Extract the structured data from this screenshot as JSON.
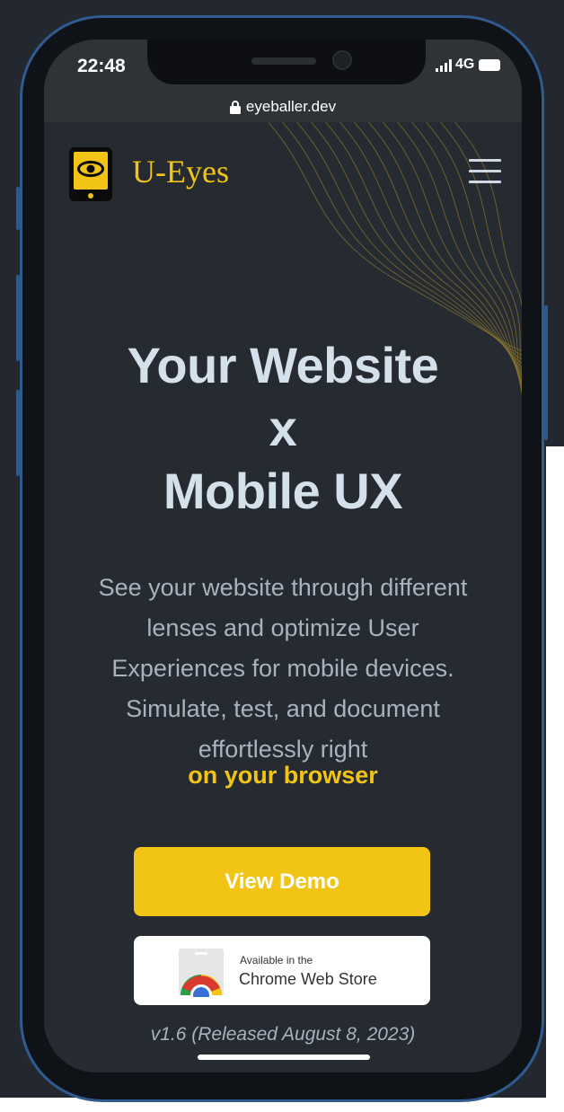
{
  "status_bar": {
    "time": "22:48",
    "network": "4G"
  },
  "browser": {
    "url": "eyeballer.dev"
  },
  "header": {
    "brand": "U-Eyes"
  },
  "hero": {
    "line1": "Your Website",
    "line2": "x",
    "line3": "Mobile UX",
    "description_lines": [
      "See your website through different",
      "lenses and optimize User",
      "Experiences for mobile devices.",
      "Simulate, test, and document",
      "effortlessly right"
    ],
    "highlight": "on your browser"
  },
  "actions": {
    "demo_label": "View Demo",
    "store_small": "Available in the",
    "store_large": "Chrome Web Store"
  },
  "footer": {
    "version": "v1.6 (Released August 8, 2023)"
  },
  "colors": {
    "accent": "#f2c416",
    "background": "#262a31",
    "heading": "#d4e0ea",
    "body_text": "#a7b3bf"
  },
  "icons": [
    "lock-icon",
    "eye-phone-logo-icon",
    "hamburger-menu-icon",
    "chrome-web-store-icon",
    "signal-icon",
    "battery-icon"
  ]
}
